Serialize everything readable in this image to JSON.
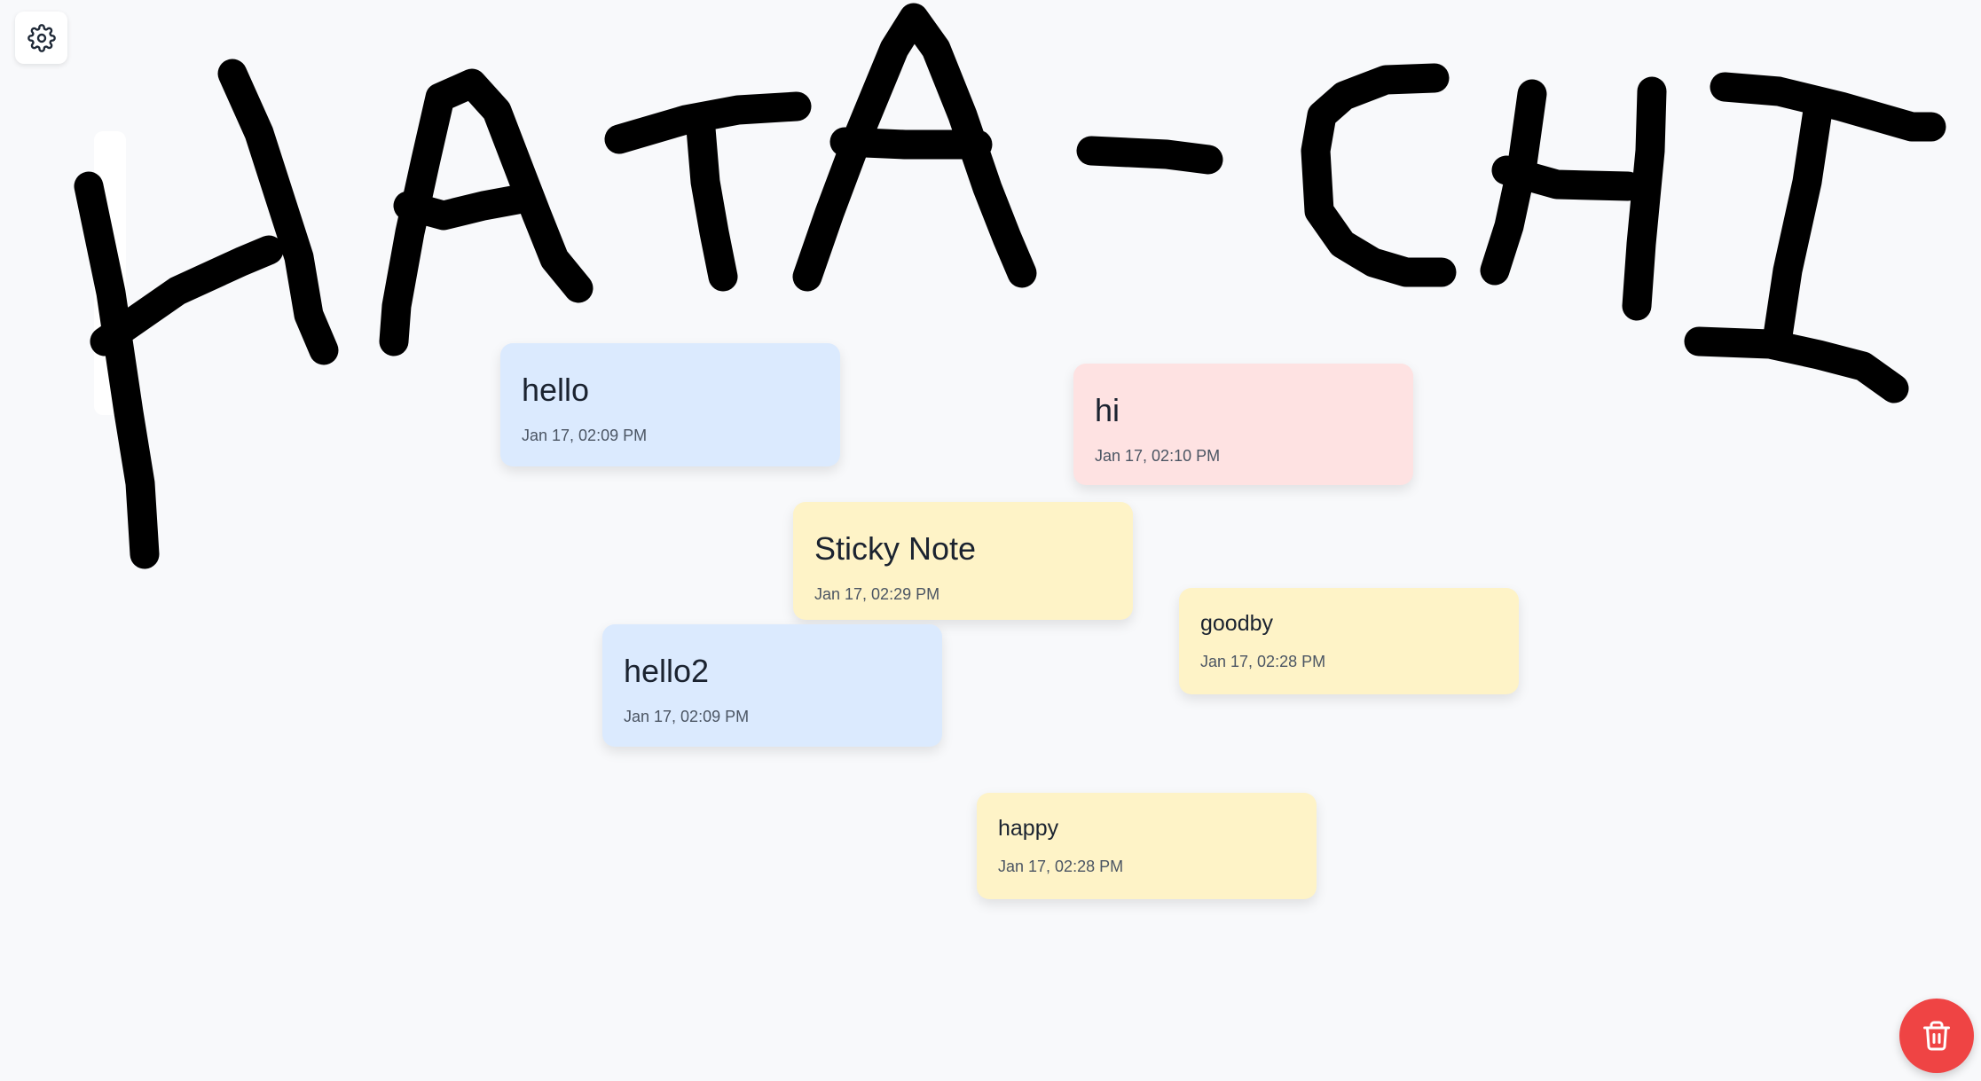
{
  "colors": {
    "background": "#f8f9fb",
    "ink": "#000000",
    "note_blue": "#dbeafe",
    "note_pink": "#fee2e2",
    "note_yellow": "#fef3c7",
    "trash_button": "#ef4444"
  },
  "toolbar": {
    "settings_icon": "gear-icon",
    "trash_icon": "trash-icon"
  },
  "drawing": {
    "handwritten_text": "HATA-CHI"
  },
  "notes": [
    {
      "title": "hello",
      "timestamp": "Jan 17, 02:09 PM",
      "color": "blue"
    },
    {
      "title": "hi",
      "timestamp": "Jan 17, 02:10 PM",
      "color": "pink"
    },
    {
      "title": "Sticky Note",
      "timestamp": "Jan 17, 02:29 PM",
      "color": "yellow"
    },
    {
      "title": "goodby",
      "timestamp": "Jan 17, 02:28 PM",
      "color": "yellow"
    },
    {
      "title": "hello2",
      "timestamp": "Jan 17, 02:09 PM",
      "color": "blue"
    },
    {
      "title": "happy",
      "timestamp": "Jan 17, 02:28 PM",
      "color": "yellow"
    }
  ]
}
